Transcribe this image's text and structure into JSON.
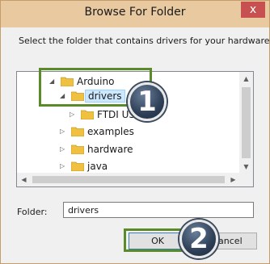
{
  "window": {
    "title": "Browse For Folder",
    "close_glyph": "x"
  },
  "instruction": "Select the folder that contains drivers for your hardware.",
  "tree": {
    "items": [
      {
        "label": "Arduino",
        "expanded": true
      },
      {
        "label": "drivers",
        "expanded": true,
        "selected": true
      },
      {
        "label": "FTDI USB",
        "expanded": false
      },
      {
        "label": "examples",
        "expanded": false
      },
      {
        "label": "hardware",
        "expanded": false
      },
      {
        "label": "java",
        "expanded": false
      }
    ]
  },
  "folder_field": {
    "label": "Folder:",
    "value": "drivers"
  },
  "buttons": {
    "ok": "OK",
    "cancel": "Cancel"
  },
  "callouts": {
    "step1": "1",
    "step2": "2",
    "highlight_color": "#5b8a2b"
  },
  "colors": {
    "titlebar": "#e8c9a0",
    "close": "#c75050",
    "selection": "#cce8ff",
    "folder": "#f0c040"
  },
  "icons": [
    "close-icon",
    "folder-icon",
    "expand-arrow-icon",
    "collapse-arrow-icon",
    "scroll-up-icon",
    "scroll-down-icon",
    "scroll-left-icon",
    "scroll-right-icon"
  ]
}
